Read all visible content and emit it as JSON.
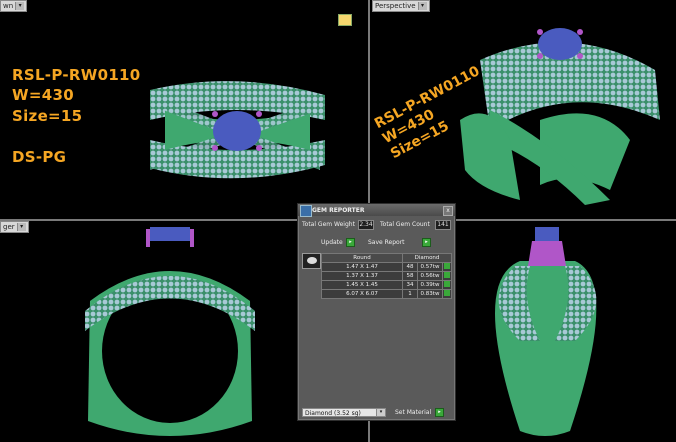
{
  "viewports": {
    "top_left": {
      "label": "wn"
    },
    "top_right": {
      "label": "Perspective"
    },
    "bottom_left": {
      "label": "ger"
    }
  },
  "info_text": {
    "code": "RSL-P-RW0110",
    "weight": "W=430",
    "size": "Size=15",
    "type": "DS-PG"
  },
  "rotated_text": {
    "line1": "RSL-P-RW0110",
    "line2": "W=430",
    "line3": "Size=15"
  },
  "gem_reporter": {
    "title": "GEM REPORTER",
    "close": "x",
    "total_weight_label": "Total Gem Weight",
    "total_weight_value": "2.34",
    "total_count_label": "Total Gem Count",
    "total_count_value": "141",
    "update_label": "Update",
    "save_report_label": "Save Report",
    "table": {
      "headers": [
        "Round",
        "Diamond"
      ],
      "rows": [
        {
          "size": "1.47 X 1.47",
          "count": "48",
          "weight": "0.57tw"
        },
        {
          "size": "1.37 X 1.37",
          "count": "58",
          "weight": "0.56tw"
        },
        {
          "size": "1.45 X 1.45",
          "count": "34",
          "weight": "0.39tw"
        },
        {
          "size": "6.07 X 6.07",
          "count": "1",
          "weight": "0.83tw"
        }
      ]
    },
    "material_select": "Diamond    (3.52 sg)",
    "set_material_label": "Set Material"
  },
  "colors": {
    "metal": "#3fa86f",
    "metal_light": "#6fd29a",
    "gem_small": "#a8c9d6",
    "center_stone": "#4a5bbf",
    "prongs": "#b056c8",
    "text_accent": "#f5a623"
  }
}
